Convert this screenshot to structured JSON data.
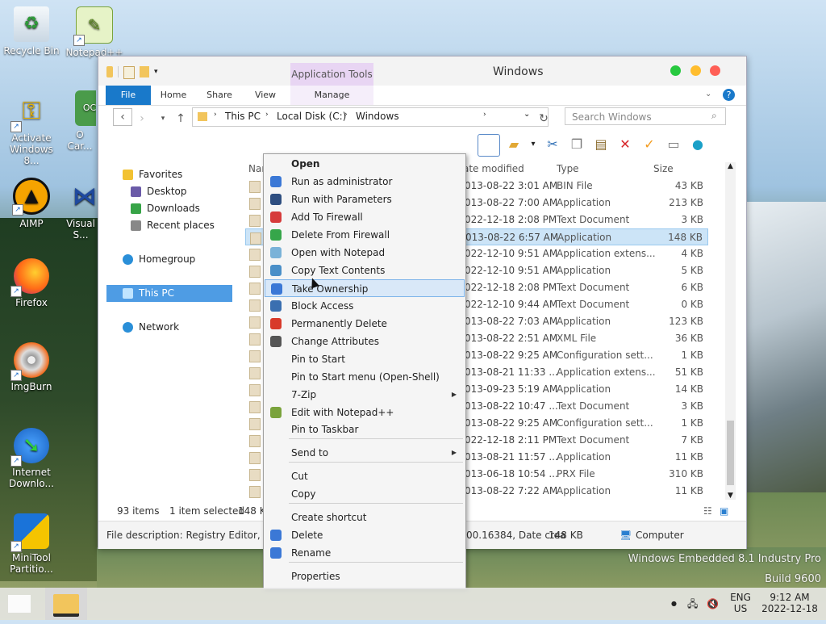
{
  "desktop": {
    "icons": [
      {
        "label": "Recycle Bin"
      },
      {
        "label": "Notepad++"
      },
      {
        "label": "Activate Windows 8..."
      },
      {
        "label": "O Car..."
      },
      {
        "label": "AIMP"
      },
      {
        "label": "Visual S..."
      },
      {
        "label": "Firefox"
      },
      {
        "label": "ImgBurn"
      },
      {
        "label": "Internet Downlo..."
      },
      {
        "label": "MiniTool Partitio..."
      }
    ],
    "watermark_line1": "Windows Embedded 8.1 Industry Pro",
    "watermark_line2": "Build 9600"
  },
  "window": {
    "title": "Windows",
    "context_tab_header": "Application Tools",
    "tabs": [
      "File",
      "Home",
      "Share",
      "View",
      "Manage"
    ],
    "breadcrumb": [
      "This PC",
      "Local Disk (C:)",
      "Windows"
    ],
    "search_placeholder": "Search Windows",
    "nav": {
      "favorites": "Favorites",
      "desktop": "Desktop",
      "downloads": "Downloads",
      "recent": "Recent places",
      "homegroup": "Homegroup",
      "this_pc": "This PC",
      "network": "Network"
    },
    "columns": {
      "name": "Nam",
      "date": "ate modified",
      "type": "Type",
      "size": "Size"
    },
    "rows": [
      {
        "date": "013-08-22 3:01 AM",
        "type": "BIN File",
        "size": "43 KB"
      },
      {
        "date": "013-08-22 7:00 AM",
        "type": "Application",
        "size": "213 KB"
      },
      {
        "date": "022-12-18 2:08 PM",
        "type": "Text Document",
        "size": "3 KB"
      },
      {
        "date": "013-08-22 6:57 AM",
        "type": "Application",
        "size": "148 KB",
        "selected": true
      },
      {
        "date": "022-12-10 9:51 AM",
        "type": "Application extens...",
        "size": "4 KB"
      },
      {
        "date": "022-12-10 9:51 AM",
        "type": "Application",
        "size": "5 KB"
      },
      {
        "date": "022-12-18 2:08 PM",
        "type": "Text Document",
        "size": "6 KB"
      },
      {
        "date": "022-12-10 9:44 AM",
        "type": "Text Document",
        "size": "0 KB"
      },
      {
        "date": "013-08-22 7:03 AM",
        "type": "Application",
        "size": "123 KB"
      },
      {
        "date": "013-08-22 2:51 AM",
        "type": "XML File",
        "size": "36 KB"
      },
      {
        "date": "013-08-22 9:25 AM",
        "type": "Configuration sett...",
        "size": "1 KB"
      },
      {
        "date": "013-08-21 11:33 ...",
        "type": "Application extens...",
        "size": "51 KB"
      },
      {
        "date": "013-09-23 5:19 AM",
        "type": "Application",
        "size": "14 KB"
      },
      {
        "date": "013-08-22 10:47 ...",
        "type": "Text Document",
        "size": "3 KB"
      },
      {
        "date": "013-08-22 9:25 AM",
        "type": "Configuration sett...",
        "size": "1 KB"
      },
      {
        "date": "022-12-18 2:11 PM",
        "type": "Text Document",
        "size": "7 KB"
      },
      {
        "date": "013-08-21 11:57 ...",
        "type": "Application",
        "size": "11 KB"
      },
      {
        "date": "013-06-18 10:54 ...",
        "type": "PRX File",
        "size": "310 KB"
      },
      {
        "date": "013-08-22 7:22 AM",
        "type": "Application",
        "size": "11 KB"
      }
    ],
    "status": {
      "count": "93 items",
      "selected": "1 item selected",
      "size": "148 KB"
    },
    "details": {
      "description": "File description: Registry Editor, Com",
      "version": "00.16384, Date crea",
      "size": "148 KB",
      "location": "Computer"
    }
  },
  "context_menu": {
    "items": [
      {
        "label": "Open",
        "bold": true
      },
      {
        "label": "Run as administrator",
        "icon": "shield-icon"
      },
      {
        "label": "Run with Parameters",
        "icon": "window-icon"
      },
      {
        "label": "Add To Firewall",
        "icon": "firewall-add-icon"
      },
      {
        "label": "Delete From Firewall",
        "icon": "firewall-delete-icon"
      },
      {
        "label": "Open with Notepad",
        "icon": "notepad-icon"
      },
      {
        "label": "Copy Text Contents",
        "icon": "copy-text-icon"
      },
      {
        "label": "Take Ownership",
        "icon": "shield-icon",
        "highlighted": true
      },
      {
        "label": "Block Access",
        "icon": "lock-icon"
      },
      {
        "label": "Permanently Delete",
        "icon": "delete-x-icon"
      },
      {
        "label": "Change Attributes",
        "icon": "checkbox-icon"
      },
      {
        "label": "Pin to Start"
      },
      {
        "label": "Pin to Start menu (Open-Shell)"
      },
      {
        "label": "7-Zip",
        "submenu": true
      },
      {
        "label": "Edit with Notepad++",
        "icon": "notepadpp-icon"
      },
      {
        "label": "Pin to Taskbar"
      },
      {
        "label": "Send to",
        "submenu": true
      },
      {
        "label": "Cut"
      },
      {
        "label": "Copy"
      },
      {
        "label": "Create shortcut"
      },
      {
        "label": "Delete",
        "icon": "shield-icon"
      },
      {
        "label": "Rename",
        "icon": "shield-icon"
      },
      {
        "label": "Properties"
      }
    ]
  },
  "taskbar": {
    "lang_top": "ENG",
    "lang_bottom": "US",
    "time": "9:12 AM",
    "date": "2022-12-18"
  }
}
